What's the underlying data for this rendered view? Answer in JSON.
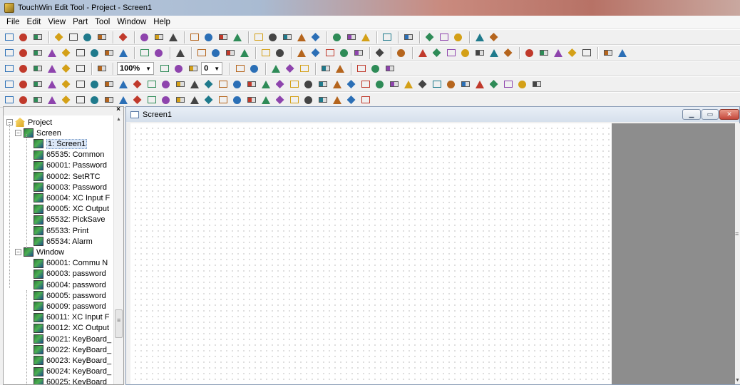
{
  "app": {
    "title": "TouchWin Edit Tool - Project - Screen1"
  },
  "menu": [
    "File",
    "Edit",
    "View",
    "Part",
    "Tool",
    "Window",
    "Help"
  ],
  "toolbar": {
    "zoom": "100%",
    "step": "0"
  },
  "toolbar_row1": [
    "new",
    "open",
    "save",
    "sep",
    "cut",
    "copy",
    "paste",
    "undo",
    "sep",
    "help",
    "sep",
    "text-A",
    "text-aa",
    "text-aa2",
    "sep",
    "shape-g1",
    "shape-g2",
    "shape-g3",
    "shape-g4",
    "sep",
    "disp1",
    "disp2",
    "disp3",
    "disp4",
    "disp5",
    "sep",
    "btn1",
    "btn2",
    "btn3",
    "sep",
    "trend",
    "sep",
    "alarm",
    "sep",
    "net1",
    "net2",
    "net3",
    "sep",
    "chart1",
    "chart2"
  ],
  "toolbar_row2": [
    "line",
    "arc",
    "rect",
    "roundrect",
    "ellipse",
    "polygon",
    "fill",
    "frame",
    "image",
    "sep",
    "palette",
    "color",
    "sep",
    "select",
    "sep",
    "lamp",
    "gauge",
    "meter",
    "star",
    "sep",
    "panel",
    "win",
    "sep",
    "down",
    "bar1",
    "bar2",
    "bar3",
    "bar4",
    "sep",
    "tbl",
    "sep",
    "grid",
    "sep",
    "trend1",
    "trend2",
    "trend3",
    "trend4",
    "trend5",
    "trend6",
    "trend7",
    "sep",
    "tab1",
    "tab2",
    "tab3",
    "tab4",
    "tab5",
    "sep",
    "cfg1",
    "cfg2"
  ],
  "toolbar_row3": [
    "align-l",
    "align-c",
    "align-r",
    "align-t",
    "align-m",
    "align-b",
    "sep",
    "zoom-out",
    "sep",
    "zoom-combo",
    "zoom-in",
    "grid",
    "hand",
    "step-combo",
    "sep",
    "pic1",
    "pic2",
    "sep",
    "copy-prop",
    "paste-prop",
    "del",
    "sep",
    "fx1",
    "fx2",
    "sep",
    "mod1",
    "mod2",
    "mod3"
  ],
  "toolbar_row4": [
    "t1",
    "t2",
    "t3",
    "t4",
    "t5",
    "t6",
    "t7",
    "t8",
    "t9",
    "t10",
    "t11",
    "t12",
    "t13",
    "t14",
    "t15",
    "t16",
    "t17",
    "t18",
    "t19",
    "t20",
    "t21",
    "t22",
    "t23",
    "t24",
    "t25",
    "t26",
    "t27",
    "t28",
    "t29",
    "t30",
    "t31",
    "t32",
    "t33",
    "t34",
    "t35",
    "t36",
    "t37",
    "t38"
  ],
  "toolbar_row5": [
    "u1",
    "u2",
    "u3",
    "u4",
    "u5",
    "u6",
    "u7",
    "u8",
    "u9",
    "u10",
    "u11",
    "u12",
    "u13",
    "u14",
    "u15",
    "u16",
    "u17",
    "u18",
    "u19",
    "u20",
    "u21",
    "u22",
    "u23",
    "u24",
    "u25",
    "u26"
  ],
  "tree": {
    "root": "Project",
    "screen_folder": "Screen",
    "screens": [
      "1: Screen1",
      "65535: Common",
      "60001: Password",
      "60002: SetRTC",
      "60003: Password",
      "60004: XC Input F",
      "60005: XC Output",
      "65532: PickSave",
      "65533: Print",
      "65534: Alarm"
    ],
    "window_folder": "Window",
    "windows": [
      "60001: Commu N",
      "60003: password",
      "60004: password",
      "60005: password",
      "60009: password",
      "60011: XC Input F",
      "60012: XC Output",
      "60021: KeyBoard_",
      "60022: KeyBoard_",
      "60023: KeyBoard_",
      "60024: KeyBoard_",
      "60025: KeyBoard_"
    ]
  },
  "child_window": {
    "title": "Screen1"
  },
  "panel": {
    "close": "×"
  }
}
